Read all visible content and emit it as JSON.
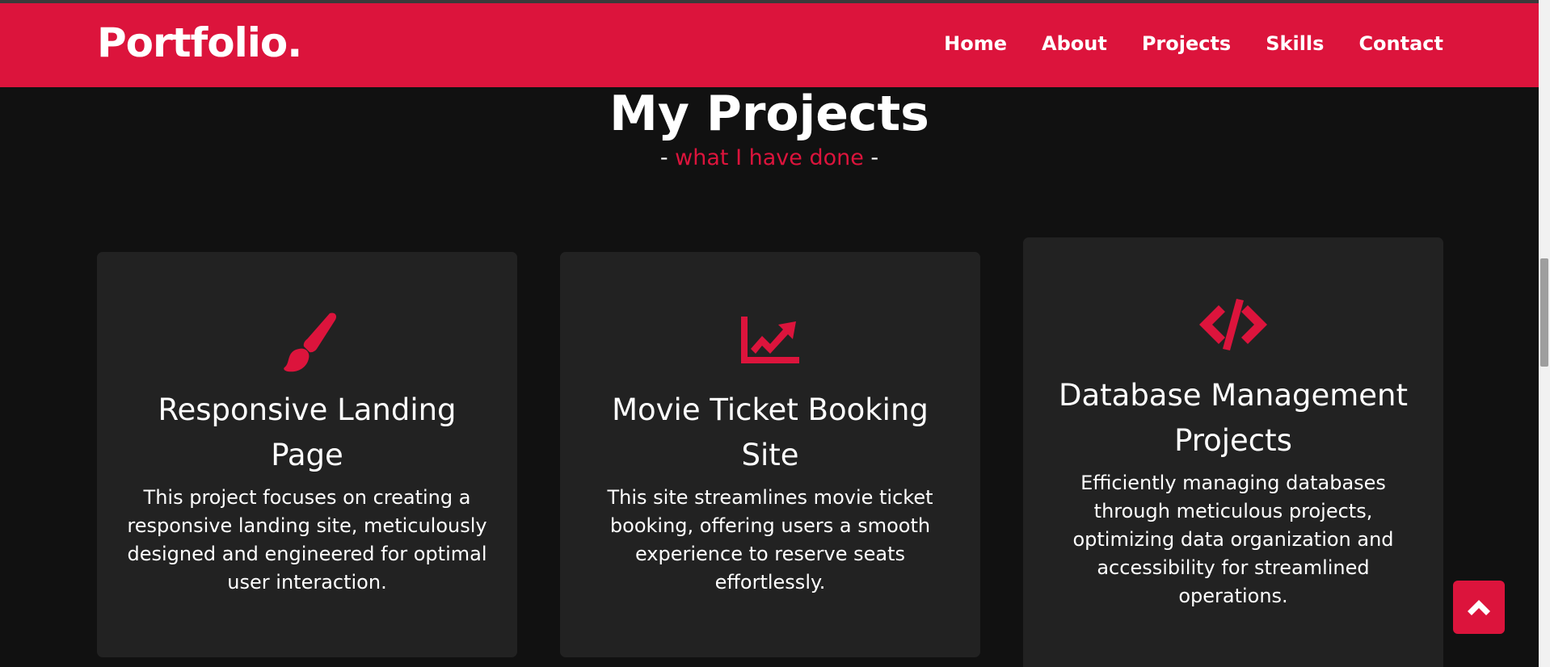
{
  "nav": {
    "logo": "Portfolio.",
    "links": [
      "Home",
      "About",
      "Projects",
      "Skills",
      "Contact"
    ]
  },
  "section": {
    "title": "My Projects",
    "subtitle_prefix": "-",
    "subtitle_accent": "what I have done",
    "subtitle_suffix": "-"
  },
  "projects": [
    {
      "icon": "paint-brush-icon",
      "title": "Responsive Landing Page",
      "description": "This project focuses on creating a responsive landing site, meticulously designed and engineered for optimal user interaction."
    },
    {
      "icon": "chart-line-icon",
      "title": "Movie Ticket Booking Site",
      "description": "This site streamlines movie ticket booking, offering users a smooth experience to reserve seats effortlessly."
    },
    {
      "icon": "code-icon",
      "title": "Database Management Projects",
      "description": "Efficiently managing databases through meticulous projects, optimizing data organization and accessibility for streamlined operations."
    }
  ],
  "colors": {
    "accent": "#dc143c",
    "background": "#111111",
    "card": "#222222"
  },
  "scroll_to_top": {
    "icon": "chevron-up-icon"
  }
}
